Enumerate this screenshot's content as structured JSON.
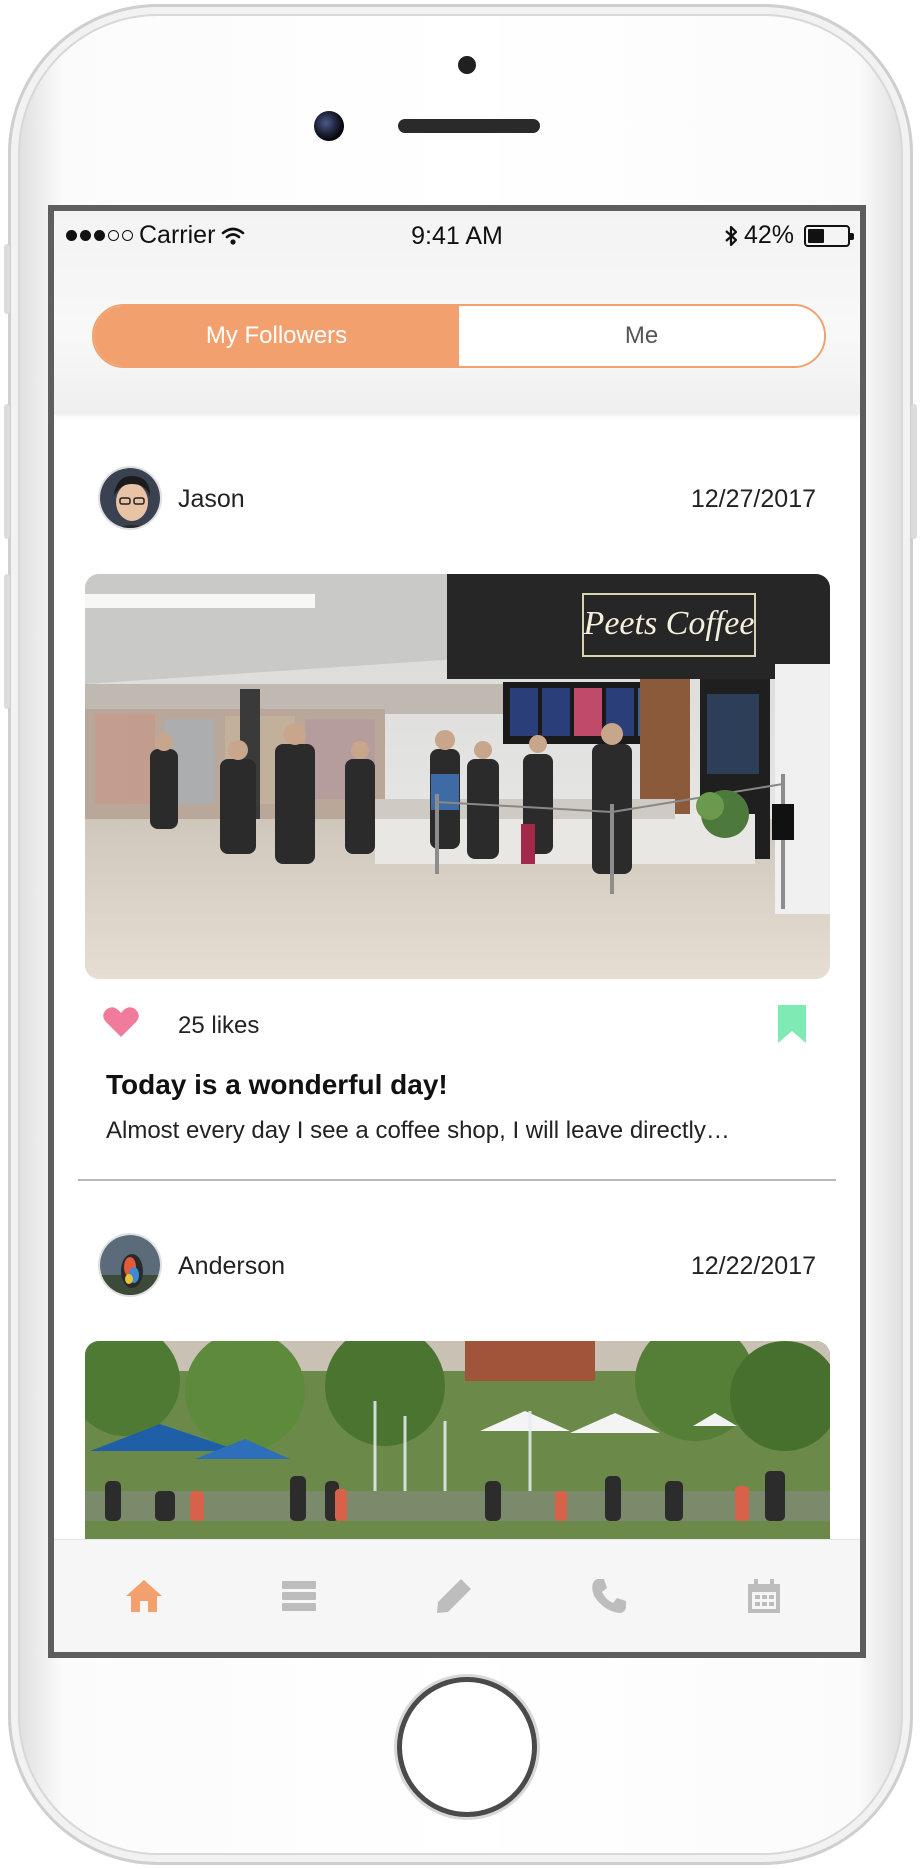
{
  "status_bar": {
    "carrier": "Carrier",
    "time": "9:41 AM",
    "battery": "42%",
    "battery_level": 0.42
  },
  "segment": {
    "options": [
      "My Followers",
      "Me"
    ],
    "selected": "My Followers",
    "accent_color": "#f3a06f"
  },
  "posts": [
    {
      "user": "Jason",
      "date": "12/27/2017",
      "likes": "25 likes",
      "title": "Today is a wonderful day!",
      "body": "Almost every day I see a coffee shop, I will leave directly…",
      "photo_sign": "Peets Coffee",
      "heart_color": "#f07b9a",
      "bookmark_color": "#7eeab4"
    },
    {
      "user": "Anderson",
      "date": "12/22/2017"
    }
  ],
  "tabbar": {
    "items": [
      {
        "icon": "home-icon",
        "active": true
      },
      {
        "icon": "list-icon",
        "active": false
      },
      {
        "icon": "pencil-icon",
        "active": false
      },
      {
        "icon": "phone-icon",
        "active": false
      },
      {
        "icon": "calendar-icon",
        "active": false
      }
    ],
    "active_color": "#f3a06f",
    "inactive_color": "#bdbdbd"
  }
}
